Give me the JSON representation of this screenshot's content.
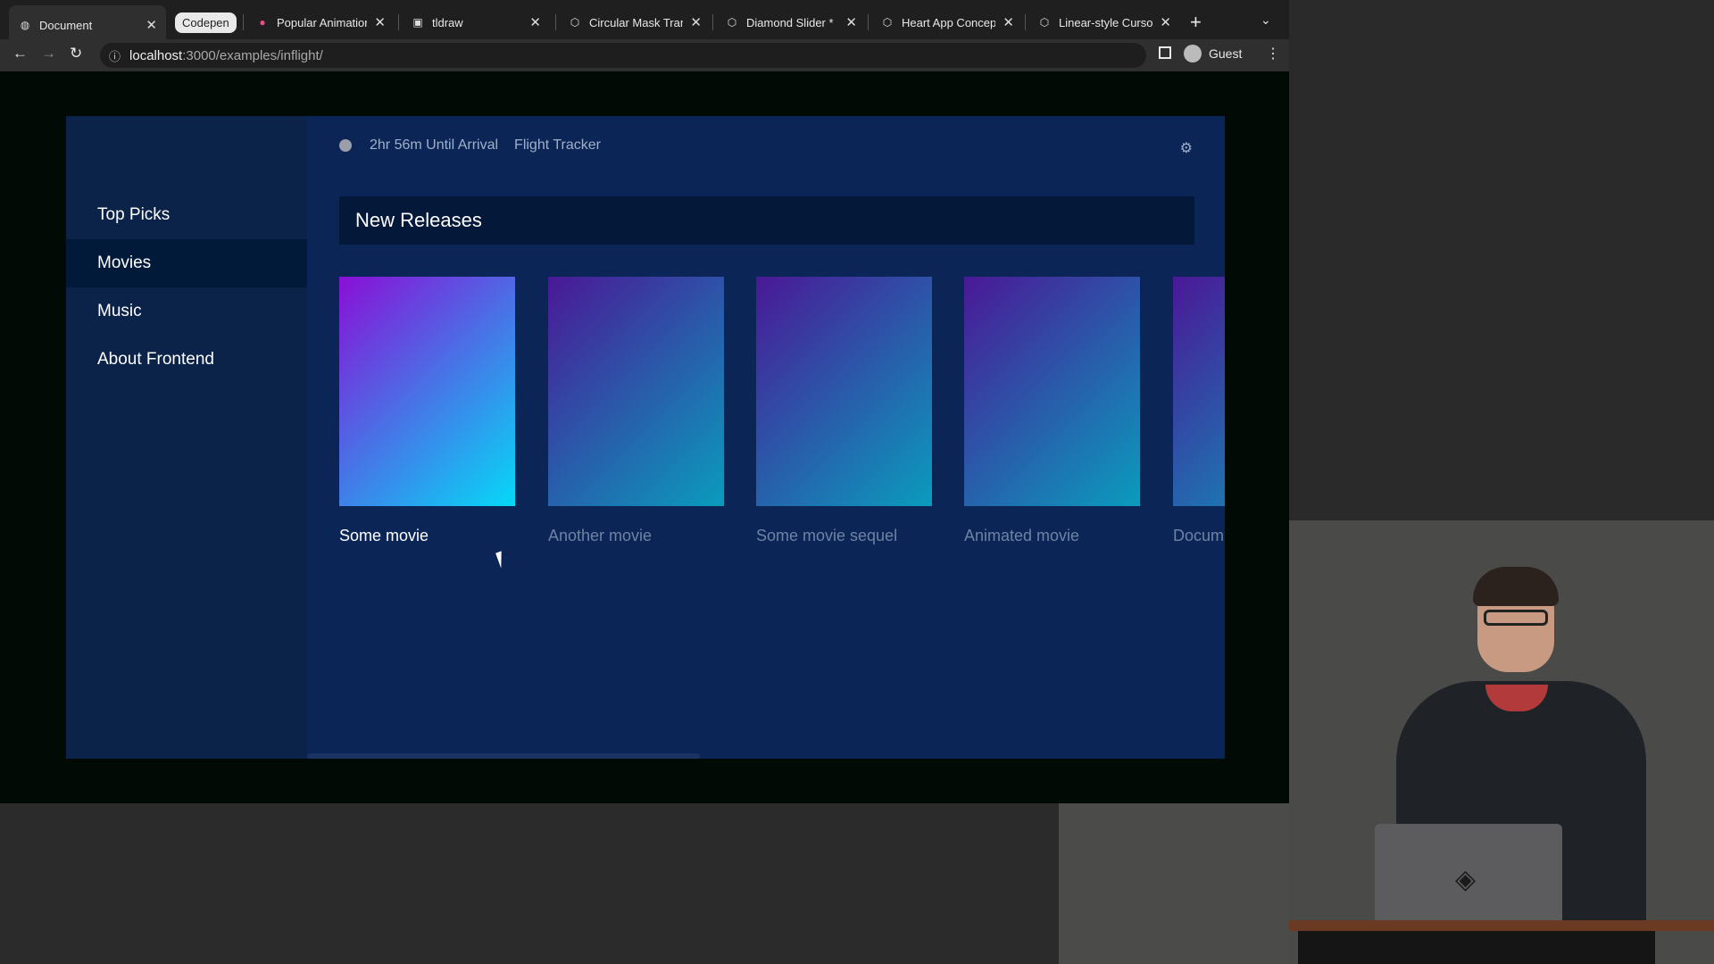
{
  "browser": {
    "tabs": [
      {
        "title": "Document",
        "icon": "globe-icon",
        "active": true
      },
      {
        "title": "Codepen",
        "icon": "",
        "pill": true
      },
      {
        "title": "Popular Animation ...",
        "icon": "dribbble-icon"
      },
      {
        "title": "tldraw",
        "icon": "tldraw-icon"
      },
      {
        "title": "Circular Mask Trans...",
        "icon": "codepen-icon"
      },
      {
        "title": "Diamond Slider *",
        "icon": "codepen-icon"
      },
      {
        "title": "Heart App Concep...",
        "icon": "codepen-icon"
      },
      {
        "title": "Linear-style Cursor...",
        "icon": "codepen-icon"
      }
    ],
    "url_host": "localhost",
    "url_path": ":3000/examples/inflight/",
    "profile_label": "Guest"
  },
  "app": {
    "sidebar": {
      "items": [
        {
          "label": "Top Picks"
        },
        {
          "label": "Movies",
          "active": true
        },
        {
          "label": "Music"
        },
        {
          "label": "About Frontend"
        }
      ]
    },
    "topbar": {
      "arrival": "2hr 56m Until Arrival",
      "tracker": "Flight Tracker"
    },
    "section_title": "New Releases",
    "movies": [
      {
        "title": "Some movie",
        "active": true,
        "gradient": [
          "#8a0fd6",
          "#05d9f7"
        ]
      },
      {
        "title": "Another movie",
        "gradient": [
          "#4a1896",
          "#0a9cbd"
        ]
      },
      {
        "title": "Some movie sequel",
        "gradient": [
          "#4a1896",
          "#0a9cbd"
        ]
      },
      {
        "title": "Animated movie",
        "gradient": [
          "#4a1896",
          "#0a9cbd"
        ]
      },
      {
        "title": "Docum",
        "gradient": [
          "#4a1896",
          "#0a9cbd"
        ]
      }
    ]
  },
  "colors": {
    "sidebar_bg": "#0b2249",
    "main_bg": "#0b2557",
    "active_item_bg": "#021a3a",
    "section_head_bg": "#04193a"
  }
}
